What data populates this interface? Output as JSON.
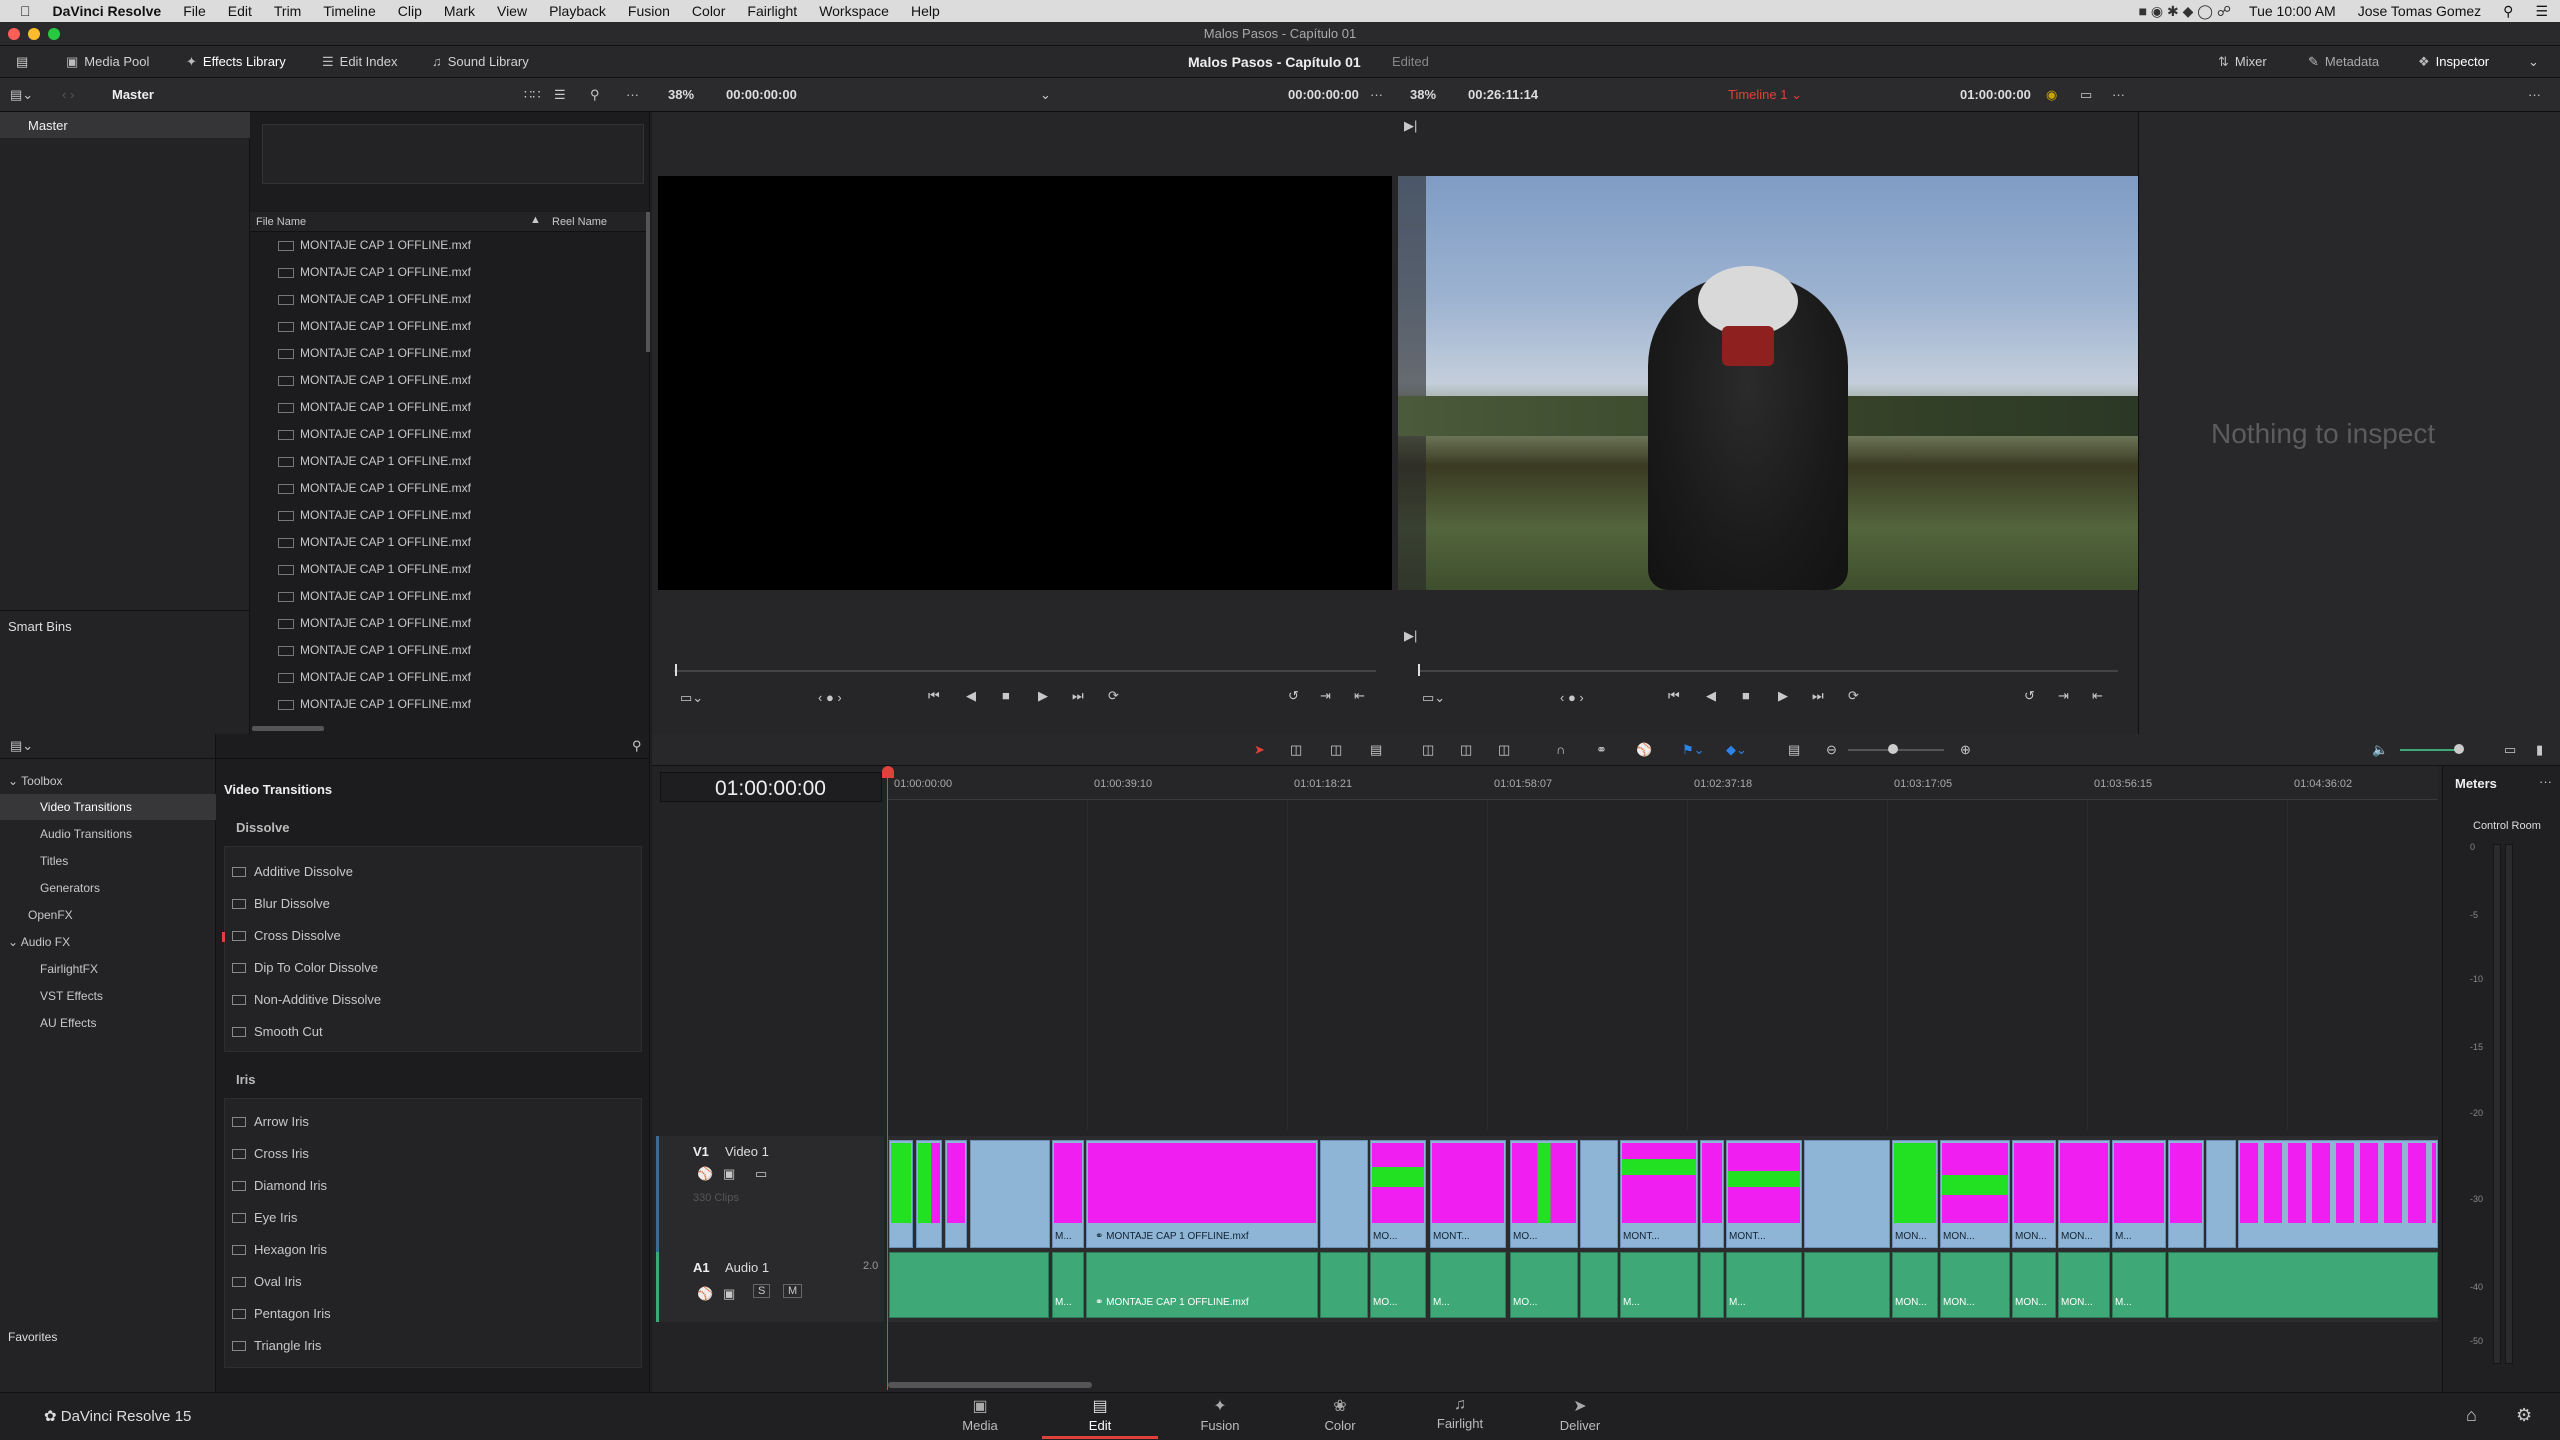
{
  "menubar": {
    "apple": "",
    "app": "DaVinci Resolve",
    "items": [
      "File",
      "Edit",
      "Trim",
      "Timeline",
      "Clip",
      "Mark",
      "View",
      "Playback",
      "Fusion",
      "Color",
      "Fairlight",
      "Workspace",
      "Help"
    ],
    "clock": "Tue 10:00 AM",
    "user": "Jose Tomas Gomez"
  },
  "window_title": "Malos Pasos - Capítulo 01",
  "toolbar": {
    "media_pool": "Media Pool",
    "effects_library": "Effects Library",
    "edit_index": "Edit Index",
    "sound_library": "Sound Library",
    "project_name": "Malos Pasos - Capítulo 01",
    "project_status": "Edited",
    "mixer": "Mixer",
    "metadata": "Metadata",
    "inspector": "Inspector"
  },
  "subbar": {
    "bin": "Master",
    "src_zoom": "38%",
    "src_tc": "00:00:00:00",
    "src_tc2": "00:00:00:00",
    "tl_zoom": "38%",
    "tl_dur": "00:26:11:14",
    "timeline_name": "Timeline 1",
    "tl_tc": "01:00:00:00"
  },
  "bins": {
    "master": "Master",
    "smart_bins": "Smart Bins",
    "favorites": "Favorites"
  },
  "mediapool": {
    "col_file": "File Name",
    "col_reel": "Reel Name",
    "files": [
      "MONTAJE CAP 1 OFFLINE.mxf",
      "MONTAJE CAP 1 OFFLINE.mxf",
      "MONTAJE CAP 1 OFFLINE.mxf",
      "MONTAJE CAP 1 OFFLINE.mxf",
      "MONTAJE CAP 1 OFFLINE.mxf",
      "MONTAJE CAP 1 OFFLINE.mxf",
      "MONTAJE CAP 1 OFFLINE.mxf",
      "MONTAJE CAP 1 OFFLINE.mxf",
      "MONTAJE CAP 1 OFFLINE.mxf",
      "MONTAJE CAP 1 OFFLINE.mxf",
      "MONTAJE CAP 1 OFFLINE.mxf",
      "MONTAJE CAP 1 OFFLINE.mxf",
      "MONTAJE CAP 1 OFFLINE.mxf",
      "MONTAJE CAP 1 OFFLINE.mxf",
      "MONTAJE CAP 1 OFFLINE.mxf",
      "MONTAJE CAP 1 OFFLINE.mxf",
      "MONTAJE CAP 1 OFFLINE.mxf",
      "MONTAJE CAP 1 OFFLINE.mxf"
    ]
  },
  "inspector": {
    "empty": "Nothing to inspect"
  },
  "toolbox": {
    "items": [
      "Toolbox",
      "Video Transitions",
      "Audio Transitions",
      "Titles",
      "Generators",
      "OpenFX",
      "Audio FX",
      "FairlightFX",
      "VST Effects",
      "AU Effects"
    ]
  },
  "effects": {
    "heading": "Video Transitions",
    "group1": "Dissolve",
    "dissolve": [
      "Additive Dissolve",
      "Blur Dissolve",
      "Cross Dissolve",
      "Dip To Color Dissolve",
      "Non-Additive Dissolve",
      "Smooth Cut"
    ],
    "group2": "Iris",
    "iris": [
      "Arrow Iris",
      "Cross Iris",
      "Diamond Iris",
      "Eye Iris",
      "Hexagon Iris",
      "Oval Iris",
      "Pentagon Iris",
      "Triangle Iris"
    ]
  },
  "timeline": {
    "timecode": "01:00:00:00",
    "ticks": [
      "01:00:00:00",
      "01:00:39:10",
      "01:01:18:21",
      "01:01:58:07",
      "01:02:37:18",
      "01:03:17:05",
      "01:03:56:15",
      "01:04:36:02"
    ],
    "v1": "V1",
    "v1_name": "Video 1",
    "v1_clips": "330 Clips",
    "a1": "A1",
    "a1_name": "Audio 1",
    "a1_ch": "2.0",
    "solo": "S",
    "mute": "M",
    "clip_big": "MONTAJE CAP 1 OFFLINE.mxf",
    "clip_labels": [
      "M...",
      "MO...",
      "MONT...",
      "MO...",
      "MONT...",
      "MONT...",
      "MON...",
      "MON...",
      "MON...",
      "MON...",
      "M..."
    ],
    "audio_labels": [
      "M...",
      "MO...",
      "M...",
      "MO...",
      "M...",
      "M...",
      "MON...",
      "MON...",
      "MON...",
      "MON...",
      "M..."
    ]
  },
  "meters": {
    "title": "Meters",
    "room": "Control Room",
    "scale": [
      "0",
      "-5",
      "-10",
      "-15",
      "-20",
      "-30",
      "-40",
      "-50"
    ]
  },
  "pages": {
    "brand": "DaVinci Resolve 15",
    "items": [
      "Media",
      "Edit",
      "Fusion",
      "Color",
      "Fairlight",
      "Deliver"
    ],
    "active": "Edit"
  },
  "colors": {
    "accent_red": "#e0413b",
    "clip_magenta": "#f01ef0",
    "clip_green": "#22e022",
    "audio_green": "#3ea877",
    "clip_blue": "#8fb5d6"
  }
}
